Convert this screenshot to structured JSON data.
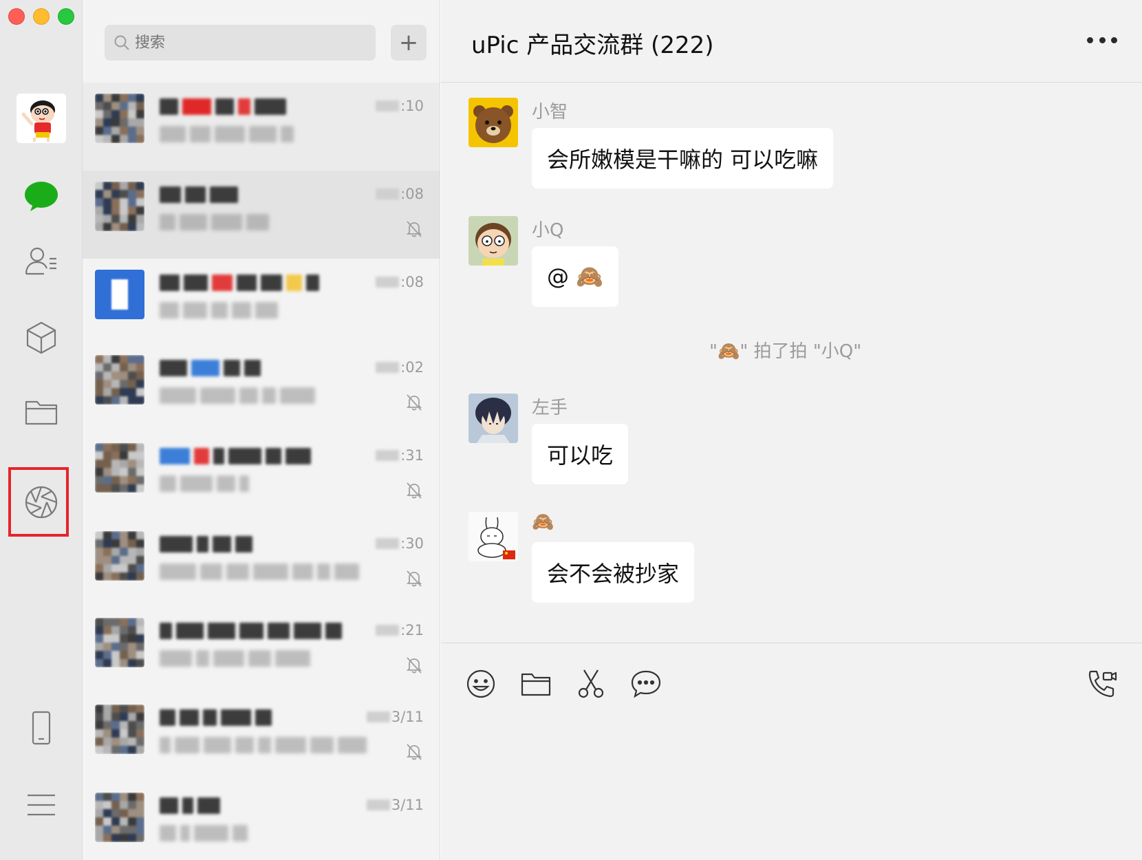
{
  "window": {
    "controls": [
      "close",
      "minimize",
      "zoom"
    ]
  },
  "rail": {
    "avatar_icon": "cartoon-boy-avatar",
    "items": [
      {
        "name": "chats",
        "icon": "chat-bubble-icon",
        "active": true
      },
      {
        "name": "contacts",
        "icon": "contacts-icon"
      },
      {
        "name": "mini-programs",
        "icon": "cube-icon"
      },
      {
        "name": "files",
        "icon": "folder-icon"
      },
      {
        "name": "moments",
        "icon": "aperture-icon",
        "highlighted": true
      },
      {
        "name": "mobile",
        "icon": "phone-icon"
      },
      {
        "name": "menu",
        "icon": "menu-icon"
      }
    ]
  },
  "search": {
    "placeholder": "搜索",
    "add_label": "+"
  },
  "conversations": [
    {
      "time": ":10",
      "muted": false
    },
    {
      "time": ":08",
      "muted": true
    },
    {
      "time": ":08",
      "muted": false
    },
    {
      "time": ":02",
      "muted": true
    },
    {
      "time": ":31",
      "muted": true
    },
    {
      "time": ":30",
      "muted": true
    },
    {
      "time": ":21",
      "muted": true
    },
    {
      "time": "3/11",
      "muted": true
    },
    {
      "time": "3/11",
      "muted": false
    }
  ],
  "chat": {
    "title": "uPic 产品交流群 (222)",
    "messages": [
      {
        "sender": "小智",
        "text": "会所嫩模是干嘛的 可以吃嘛",
        "avatar": "brown-bear-avatar"
      },
      {
        "sender": "小Q",
        "text": "@ 🙈",
        "avatar": "cartoon-boy-morty-avatar"
      },
      {
        "system": "\"🙈\" 拍了拍 \"小Q\""
      },
      {
        "sender": "左手",
        "text": "可以吃",
        "avatar": "anime-boy-avatar"
      },
      {
        "sender": "🙈",
        "text": "会不会被抄家",
        "avatar": "rabbit-sketch-avatar"
      }
    ]
  },
  "composer": {
    "tools": [
      "emoji-icon",
      "folder-icon",
      "scissors-icon",
      "chat-history-icon"
    ],
    "call_icon": "voice-video-call-icon"
  },
  "colors": {
    "rail_bg": "#e9e9e9",
    "list_bg": "#f3f3f3",
    "chat_bg": "#f2f2f2",
    "wechat_green": "#1aad19",
    "highlight_red": "#e8232a"
  }
}
